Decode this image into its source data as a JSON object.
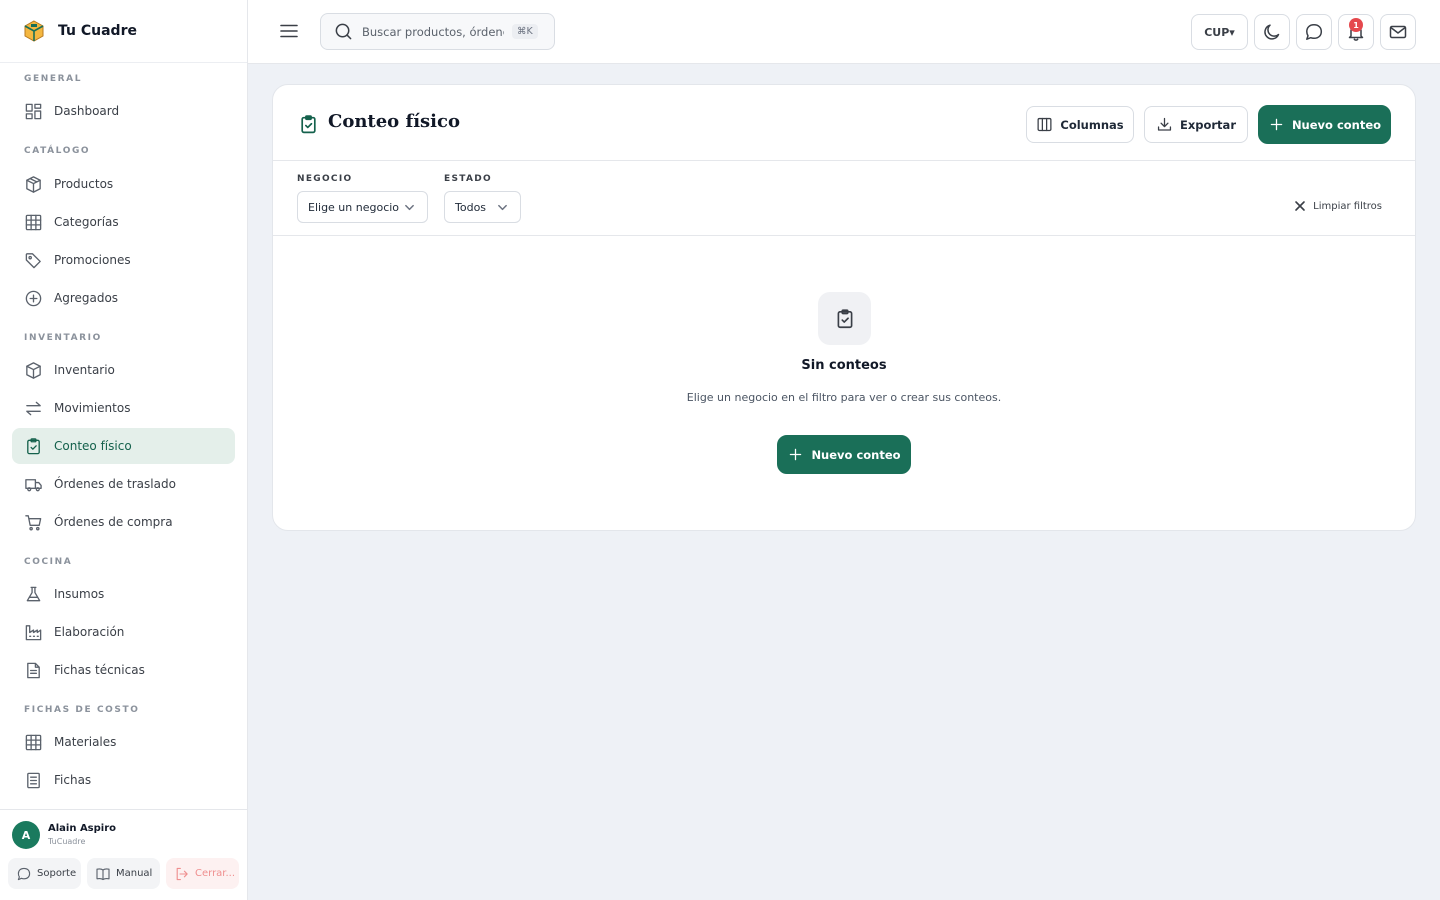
{
  "brand": {
    "name": "Tu Cuadre"
  },
  "sidebar": {
    "sections": {
      "general": "GENERAL",
      "catalogo": "CATÁLOGO",
      "inventario": "INVENTARIO",
      "cocina": "COCINA",
      "fichas_costo": "FICHAS DE COSTO"
    },
    "items": {
      "dashboard": "Dashboard",
      "productos": "Productos",
      "categorias": "Categorías",
      "promociones": "Promociones",
      "agregados": "Agregados",
      "inventario": "Inventario",
      "movimientos": "Movimientos",
      "conteo": "Conteo físico",
      "traslado": "Órdenes de traslado",
      "compra": "Órdenes de compra",
      "insumos": "Insumos",
      "elaboracion": "Elaboración",
      "fichas_tecnicas": "Fichas técnicas",
      "materiales": "Materiales",
      "fichas": "Fichas"
    },
    "active_item": "conteo"
  },
  "user": {
    "initial": "A",
    "name": "Alain Aspiro",
    "org": "TuCuadre",
    "support": "Soporte",
    "manual": "Manual",
    "logout": "Cerrar..."
  },
  "topbar": {
    "search_placeholder": "Buscar productos, órdenes...",
    "shortcut": "⌘K",
    "currency": "CUP",
    "notifications_count": "1"
  },
  "page": {
    "title": "Conteo físico",
    "columns_btn": "Columnas",
    "export_btn": "Exportar",
    "new_btn": "Nuevo conteo"
  },
  "filters": {
    "negocio_label": "NEGOCIO",
    "negocio_value": "Elige un negocio",
    "estado_label": "ESTADO",
    "estado_value": "Todos",
    "clear": "Limpiar filtros"
  },
  "empty": {
    "title": "Sin conteos",
    "description": "Elige un negocio en el filtro para ver o crear sus conteos.",
    "button": "Nuevo conteo"
  },
  "colors": {
    "primary": "#1a6f58",
    "active_bg": "#e4efea",
    "badge": "#e5484d"
  }
}
